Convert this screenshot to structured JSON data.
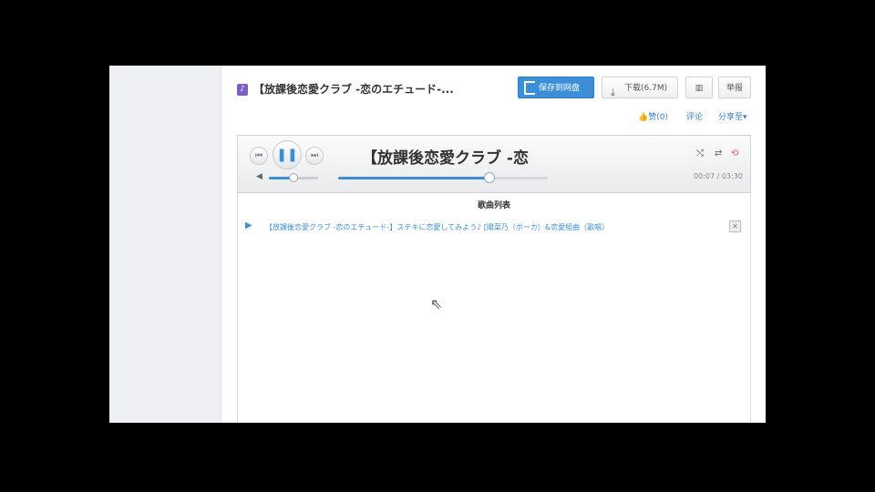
{
  "header": {
    "file_icon": "music-file-icon",
    "file_title": "【放課後恋愛クラブ -恋のエチュード-...",
    "save_label": "保存到网盘",
    "download_label": "下载(6.7M)",
    "grid_label": "▥",
    "more_label": "举报"
  },
  "actions": {
    "like": "👍赞(0)",
    "comment": "评论",
    "share": "分享至▾"
  },
  "player": {
    "track_name": "【放課後恋愛クラブ -恋",
    "prev_icon": "⏮",
    "play_icon": "❚❚",
    "next_icon": "⏭",
    "shuffle_icon": "⤭",
    "list_icon": "⇄",
    "repeat_icon": "⟲",
    "volume_icon": "◀",
    "time": "00:07 / 03:30",
    "volume_level": 0.5,
    "progress": 0.72,
    "colors": {
      "accent": "#3b8fd9",
      "repeat": "#e05a5a"
    }
  },
  "playlist": {
    "header": "歌曲列表",
    "items": [
      {
        "title": "【放課後恋愛クラブ -恋のエチュード-】ステキに恋愛してみよう♪ [陽菜乃（ボーカ）&恋愛組曲（歌唱）",
        "close": "✕"
      }
    ]
  }
}
